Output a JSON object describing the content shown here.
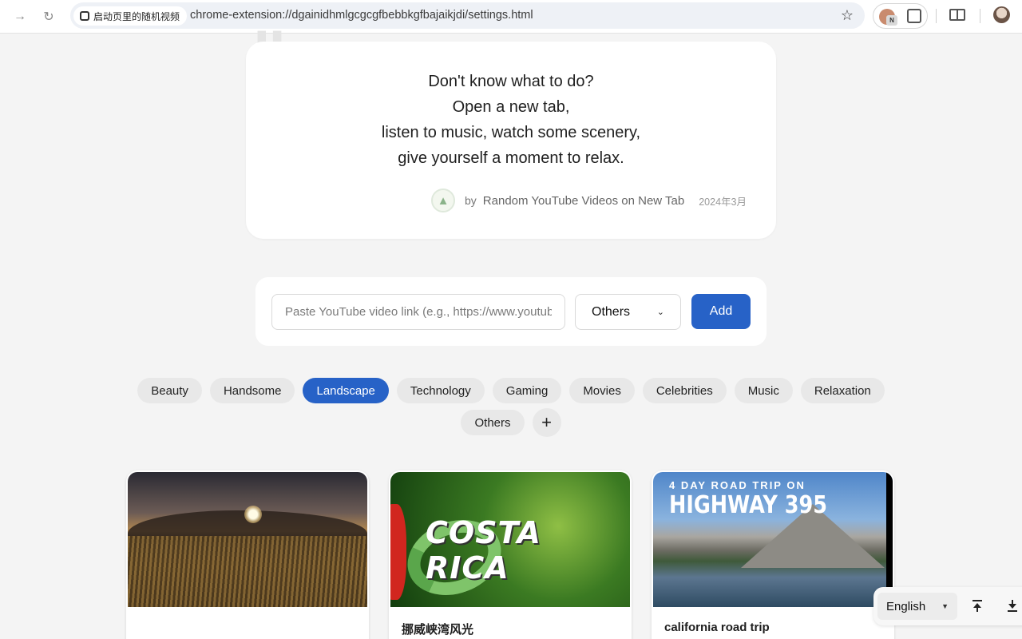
{
  "browser": {
    "site_chip_label": "启动页里的随机视频",
    "url": "chrome-extension://dgainidhmlgcgcgfbebbkgfbajaikjdi/settings.html",
    "ext_badge": "N",
    "icons": [
      "forward-icon",
      "reload-icon",
      "extension-icon",
      "bookmark-star-icon",
      "puzzle-icon",
      "reading-list-icon",
      "profile-avatar"
    ]
  },
  "quote": {
    "lines": [
      "Don't know what to do?",
      "Open a new tab,",
      "listen to music, watch some scenery,",
      "give yourself a moment to relax."
    ],
    "by": "by",
    "author": "Random YouTube Videos on New Tab",
    "date": "2024年3月"
  },
  "add_form": {
    "link_placeholder": "Paste YouTube video link (e.g., https://www.youtube.com/watch?v=...)",
    "selected_category": "Others",
    "add_label": "Add"
  },
  "categories": {
    "items": [
      "Beauty",
      "Handsome",
      "Landscape",
      "Technology",
      "Gaming",
      "Movies",
      "Celebrities",
      "Music",
      "Relaxation",
      "Others"
    ],
    "active": "Landscape",
    "add_symbol": "+"
  },
  "videos": [
    {
      "title": "",
      "thumbnail_text": {}
    },
    {
      "title": "挪威峡湾风光",
      "thumbnail_text": {
        "main": "COSTA RICA"
      }
    },
    {
      "title": "california road trip",
      "thumbnail_text": {
        "small": "4 DAY ROAD TRIP ON",
        "main": "HIGHWAY 395"
      }
    }
  ],
  "float_bar": {
    "language": "English"
  },
  "colors": {
    "accent": "#2762c7",
    "page_bg": "#f4f4f4",
    "tag_bg": "#e8e8e8"
  }
}
